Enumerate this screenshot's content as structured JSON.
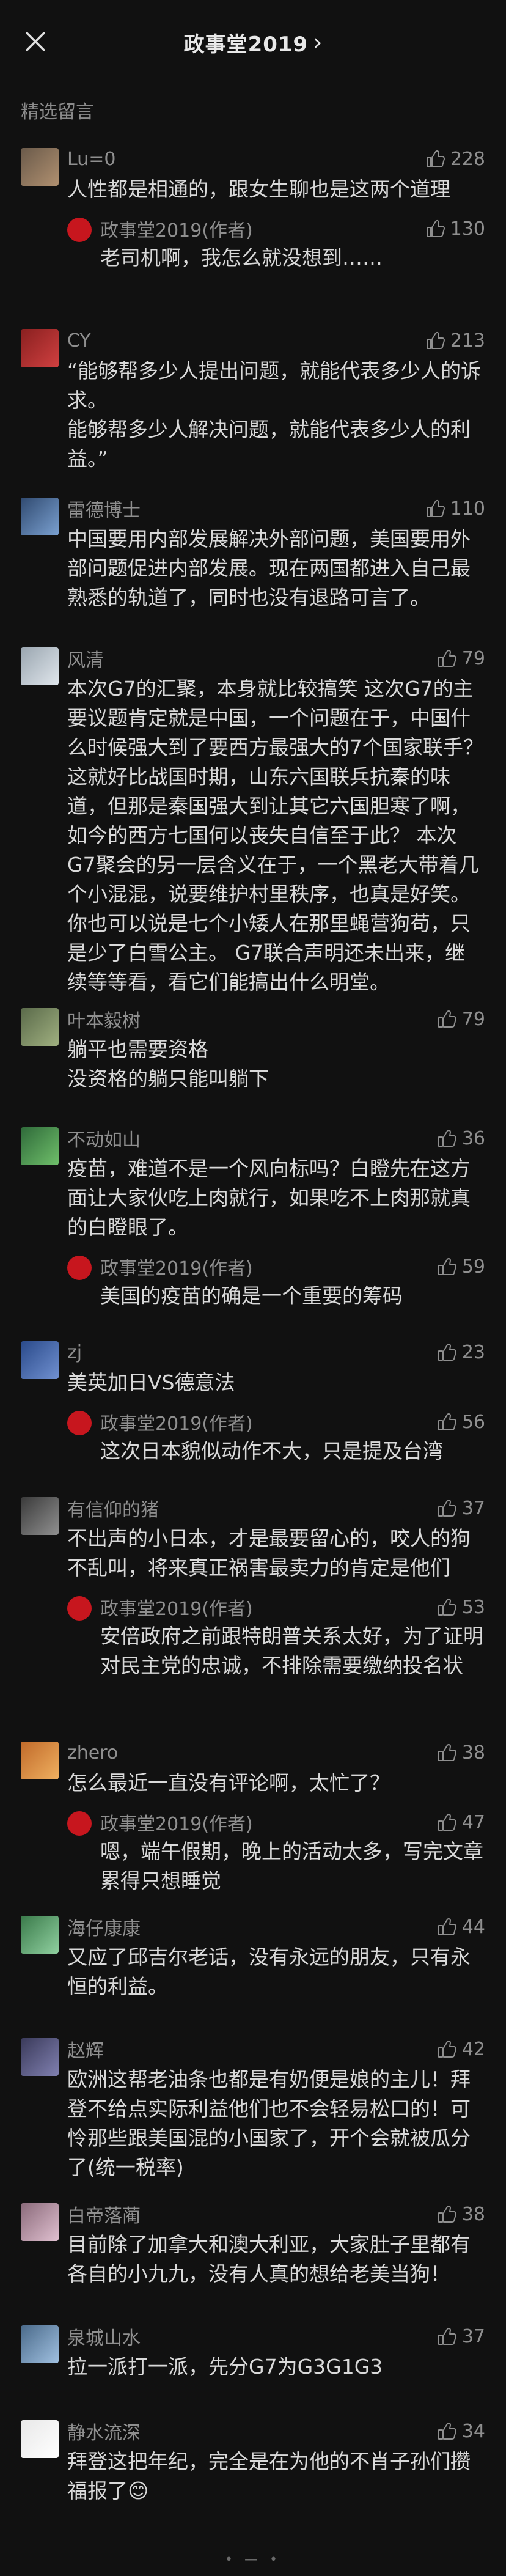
{
  "header": {
    "title": "政事堂2019",
    "chevron": "›"
  },
  "section_label": "精选留言",
  "comments": [
    {
      "nick": "Lu=0",
      "likes": "228",
      "text": "人性都是相通的，跟女生聊也是这两个道理",
      "reply": {
        "nick": "政事堂2019(作者)",
        "likes": "130",
        "text": "老司机啊，我怎么就没想到……"
      }
    },
    {
      "nick": "CY",
      "likes": "213",
      "text": "“能够帮多少人提出问题，就能代表多少人的诉求。\n能够帮多少人解决问题，就能代表多少人的利益。”"
    },
    {
      "nick": "雷德博士",
      "likes": "110",
      "text": "中国要用内部发展解决外部问题，美国要用外部问题促进内部发展。现在两国都进入自己最熟悉的轨道了，同时也没有退路可言了。"
    },
    {
      "nick": "风清",
      "likes": "79",
      "text": "本次G7的汇聚，本身就比较搞笑 这次G7的主要议题肯定就是中国，一个问题在于，中国什么时候强大到了要西方最强大的7个国家联手？ 这就好比战国时期，山东六国联兵抗秦的味道，但那是秦国强大到让其它六国胆寒了啊，如今的西方七国何以丧失自信至于此？ 本次G7聚会的另一层含义在于，一个黑老大带着几个小混混，说要维护村里秩序，也真是好笑。你也可以说是七个小矮人在那里蝇营狗苟，只是少了白雪公主。 G7联合声明还未出来，继续等等看，看它们能搞出什么明堂。"
    },
    {
      "nick": "叶本毅树",
      "likes": "79",
      "text": "躺平也需要资格\n没资格的躺只能叫躺下"
    },
    {
      "nick": "不动如山",
      "likes": "36",
      "text": "疫苗，难道不是一个风向标吗？白瞪先在这方面让大家伙吃上肉就行，如果吃不上肉那就真的白瞪眼了。",
      "reply": {
        "nick": "政事堂2019(作者)",
        "likes": "59",
        "text": "美国的疫苗的确是一个重要的筹码"
      }
    },
    {
      "nick": "zj",
      "likes": "23",
      "text": "美英加日VS德意法",
      "reply": {
        "nick": "政事堂2019(作者)",
        "likes": "56",
        "text": "这次日本貌似动作不大，只是提及台湾"
      }
    },
    {
      "nick": "有信仰的猪",
      "likes": "37",
      "text": "不出声的小日本，才是最要留心的，咬人的狗不乱叫，将来真正祸害最卖力的肯定是他们",
      "reply": {
        "nick": "政事堂2019(作者)",
        "likes": "53",
        "text": "安倍政府之前跟特朗普关系太好，为了证明对民主党的忠诚，不排除需要缴纳投名状"
      }
    },
    {
      "nick": "zhero",
      "likes": "38",
      "text": "怎么最近一直没有评论啊，太忙了？",
      "reply": {
        "nick": "政事堂2019(作者)",
        "likes": "47",
        "text": "嗯，端午假期，晚上的活动太多，写完文章累得只想睡觉"
      }
    },
    {
      "nick": "海仔康康",
      "likes": "44",
      "text": "又应了邱吉尔老话，没有永远的朋友，只有永恒的利益。"
    },
    {
      "nick": "赵辉",
      "likes": "42",
      "text": "欧洲这帮老油条也都是有奶便是娘的主儿！拜登不给点实际利益他们也不会轻易松口的！可怜那些跟美国混的小国家了，开个会就被瓜分了(统一税率)"
    },
    {
      "nick": "白帝落蔺",
      "likes": "38",
      "text": "目前除了加拿大和澳大利亚，大家肚子里都有各自的小九九，没有人真的想给老美当狗！"
    },
    {
      "nick": "泉城山水",
      "likes": "37",
      "text": "拉一派打一派，先分G7为G3G1G3"
    },
    {
      "nick": "静水流深",
      "likes": "34",
      "text": "拜登这把年纪，完全是在为他的不肖子孙们攒福报了😊"
    }
  ],
  "icons": {
    "close": "close-icon",
    "like": "thumbs-up-icon"
  },
  "colors": {
    "background": "#111111",
    "text": "#d9d9d9",
    "muted": "#8f8f8f",
    "author_badge": "#c7161e"
  }
}
